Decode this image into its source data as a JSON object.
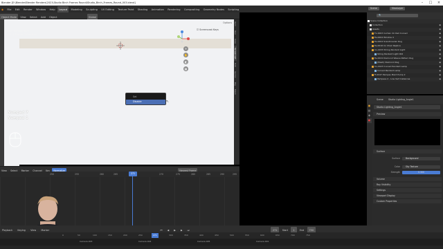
{
  "window": {
    "title": "Blender [E:\\Blender\\Blender Renders\\2021\\Studio Birch Frames Round\\Studio_Birch_Frames_Round_003.blend]",
    "minimize": "–",
    "maximize": "□",
    "close": "×"
  },
  "menu": [
    "File",
    "Edit",
    "Render",
    "Window",
    "Help"
  ],
  "workspaces": [
    "Layout",
    "Modeling",
    "Sculpting",
    "UV Editing",
    "Texture Paint",
    "Shading",
    "Animation",
    "Rendering",
    "Compositing",
    "Geometry Nodes",
    "Scripting"
  ],
  "active_workspace": "Layout",
  "scene_field": "Scene",
  "view_layer_field": "ViewLayer",
  "viewport": {
    "mode": "Object Mode",
    "menus": [
      "View",
      "Select",
      "Add",
      "Object"
    ],
    "orientation": "Global",
    "perspective_label": "User Perspective",
    "collection_label": "(271) Scene Collection",
    "options": "Options",
    "screencast_keys": "Screencast Keys",
    "numpad_lines": [
      "Numpad 7",
      "Numpad 1"
    ],
    "side_tabs": [
      "Item",
      "Tool",
      "View",
      "Screencast",
      "Edit",
      "Gizmo",
      "Rig",
      "Mesh"
    ]
  },
  "popup": {
    "items": [
      "Set",
      "Disable"
    ],
    "selected": "Disable"
  },
  "timeline": {
    "menus": [
      "View",
      "Select",
      "Marker",
      "Channel",
      "Key"
    ],
    "mode": "Normalize",
    "filter": "Nearest Frame",
    "ticks": [
      "250",
      "255",
      "260",
      "265",
      "270",
      "275",
      "280",
      "285",
      "290",
      "295"
    ],
    "current_frame": "271"
  },
  "playback": {
    "menus": [
      "Playback",
      "Keying",
      "View",
      "Marker"
    ],
    "current": "271",
    "start_label": "Start",
    "start": "1",
    "end_label": "End",
    "end": "750",
    "ticks": [
      "0",
      "50",
      "100",
      "150",
      "200",
      "250",
      "300",
      "350",
      "400",
      "450",
      "500",
      "550",
      "600",
      "650",
      "700",
      "750"
    ],
    "markers": [
      "Camera.003",
      "Camera.004",
      "Camera.005",
      "Camera.001"
    ]
  },
  "outliner": {
    "header": "Scene Collection",
    "rows": [
      "Scene Collection",
      "Collection",
      "Assets",
      "Fx-0003 Curtain On Rail Curved",
      "Fe-0004 Window 4",
      "Fe-0004 Scandinavian Rug",
      "Fe-0016 Co Chair Replica",
      "Co-0033 String Pendant Light",
      "String Pendant Light 002",
      "Fe-0024 Diamond Weave Pattern Rug",
      "(Mesh) Diamond Rug",
      "Co-0023 Curved Pendant Lamp",
      "Curved Pendant Lamp",
      "Fi-0047 Pampas Plant Pump 2",
      "Pampass 2 - Low Vert Instances"
    ]
  },
  "properties": {
    "scene_label": "Scene",
    "world": "Studio Lighting_Angle1",
    "world_field": "Studio Lighting_Angle1",
    "panels": [
      "Preview",
      "Surface",
      "Volume",
      "Ray Visibility",
      "Settings",
      "Viewport Display",
      "Custom Properties"
    ],
    "surface_rows": [
      {
        "label": "Surface",
        "value": "Background"
      },
      {
        "label": "Color",
        "value": "Sky Texture"
      },
      {
        "label": "Strength",
        "value": "0.300"
      }
    ]
  },
  "colors": {
    "accent": "#4a7cd4",
    "viewport_bg": "#f1f2f4",
    "panel_bg": "#2b2b2b"
  }
}
